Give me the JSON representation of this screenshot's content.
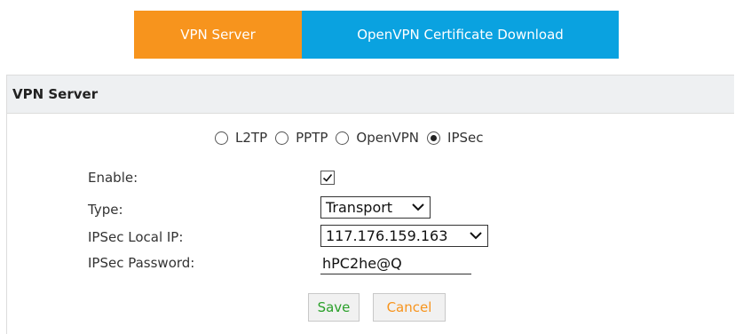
{
  "tabs": [
    {
      "label": "VPN Server",
      "active": true
    },
    {
      "label": "OpenVPN Certificate Download",
      "active": false
    }
  ],
  "panel": {
    "title": "VPN Server"
  },
  "protocols": [
    {
      "label": "L2TP",
      "selected": false
    },
    {
      "label": "PPTP",
      "selected": false
    },
    {
      "label": "OpenVPN",
      "selected": false
    },
    {
      "label": "IPSec",
      "selected": true
    }
  ],
  "form": {
    "enable_label": "Enable:",
    "enable_checked": true,
    "type_label": "Type:",
    "type_value": "Transport",
    "local_ip_label": "IPSec Local IP:",
    "local_ip_value": "117.176.159.163",
    "password_label": "IPSec Password:",
    "password_value": "hPC2he@Q"
  },
  "buttons": {
    "save": "Save",
    "cancel": "Cancel"
  },
  "colors": {
    "tab_active": "#f7941d",
    "tab_inactive": "#0aa2e0",
    "save_text": "#2aa02a",
    "cancel_text": "#f7941d"
  }
}
